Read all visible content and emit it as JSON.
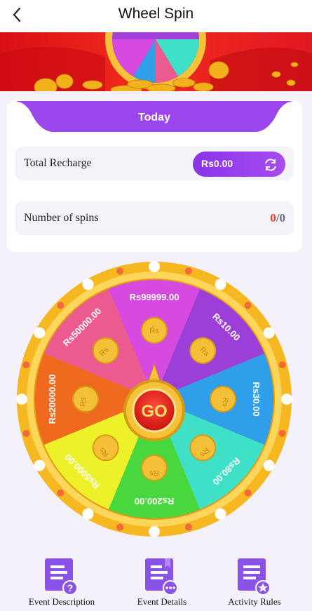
{
  "header": {
    "title": "Wheel Spin",
    "back_icon": "chevron-left-icon"
  },
  "banner": {
    "colors": {
      "background": "#e01820",
      "coin": "#f3b21c"
    }
  },
  "panel": {
    "tab_label": "Today",
    "total_recharge": {
      "label": "Total Recharge",
      "amount": "Rs0.00",
      "refresh_icon": "refresh-icon"
    },
    "spins": {
      "label": "Number of spins",
      "used": "0",
      "separator": "/",
      "total": "0"
    }
  },
  "wheel": {
    "center_label": "GO",
    "coin_symbol": "Rs",
    "segments": [
      {
        "label": "Rs99999.00",
        "color": "#d64ae0"
      },
      {
        "label": "Rs10.00",
        "color": "#9b3fd8"
      },
      {
        "label": "Rs30.00",
        "color": "#2e9fe8"
      },
      {
        "label": "Rs80.00",
        "color": "#3fe0c8"
      },
      {
        "label": "Rs200.00",
        "color": "#48d83e"
      },
      {
        "label": "Rs5000.00",
        "color": "#ecf12a"
      },
      {
        "label": "Rs20000.00",
        "color": "#ef6a1e"
      },
      {
        "label": "Rs50000.00",
        "color": "#ec5b8f"
      }
    ]
  },
  "bottom_nav": [
    {
      "label": "Event Description",
      "icon": "document-question-icon"
    },
    {
      "label": "Event Details",
      "icon": "document-more-icon"
    },
    {
      "label": "Activity Rules",
      "icon": "document-star-icon"
    }
  ],
  "colors": {
    "accent": "#9b46ec",
    "spins_used": "#e0402e",
    "spins_total": "#6b6b80"
  }
}
